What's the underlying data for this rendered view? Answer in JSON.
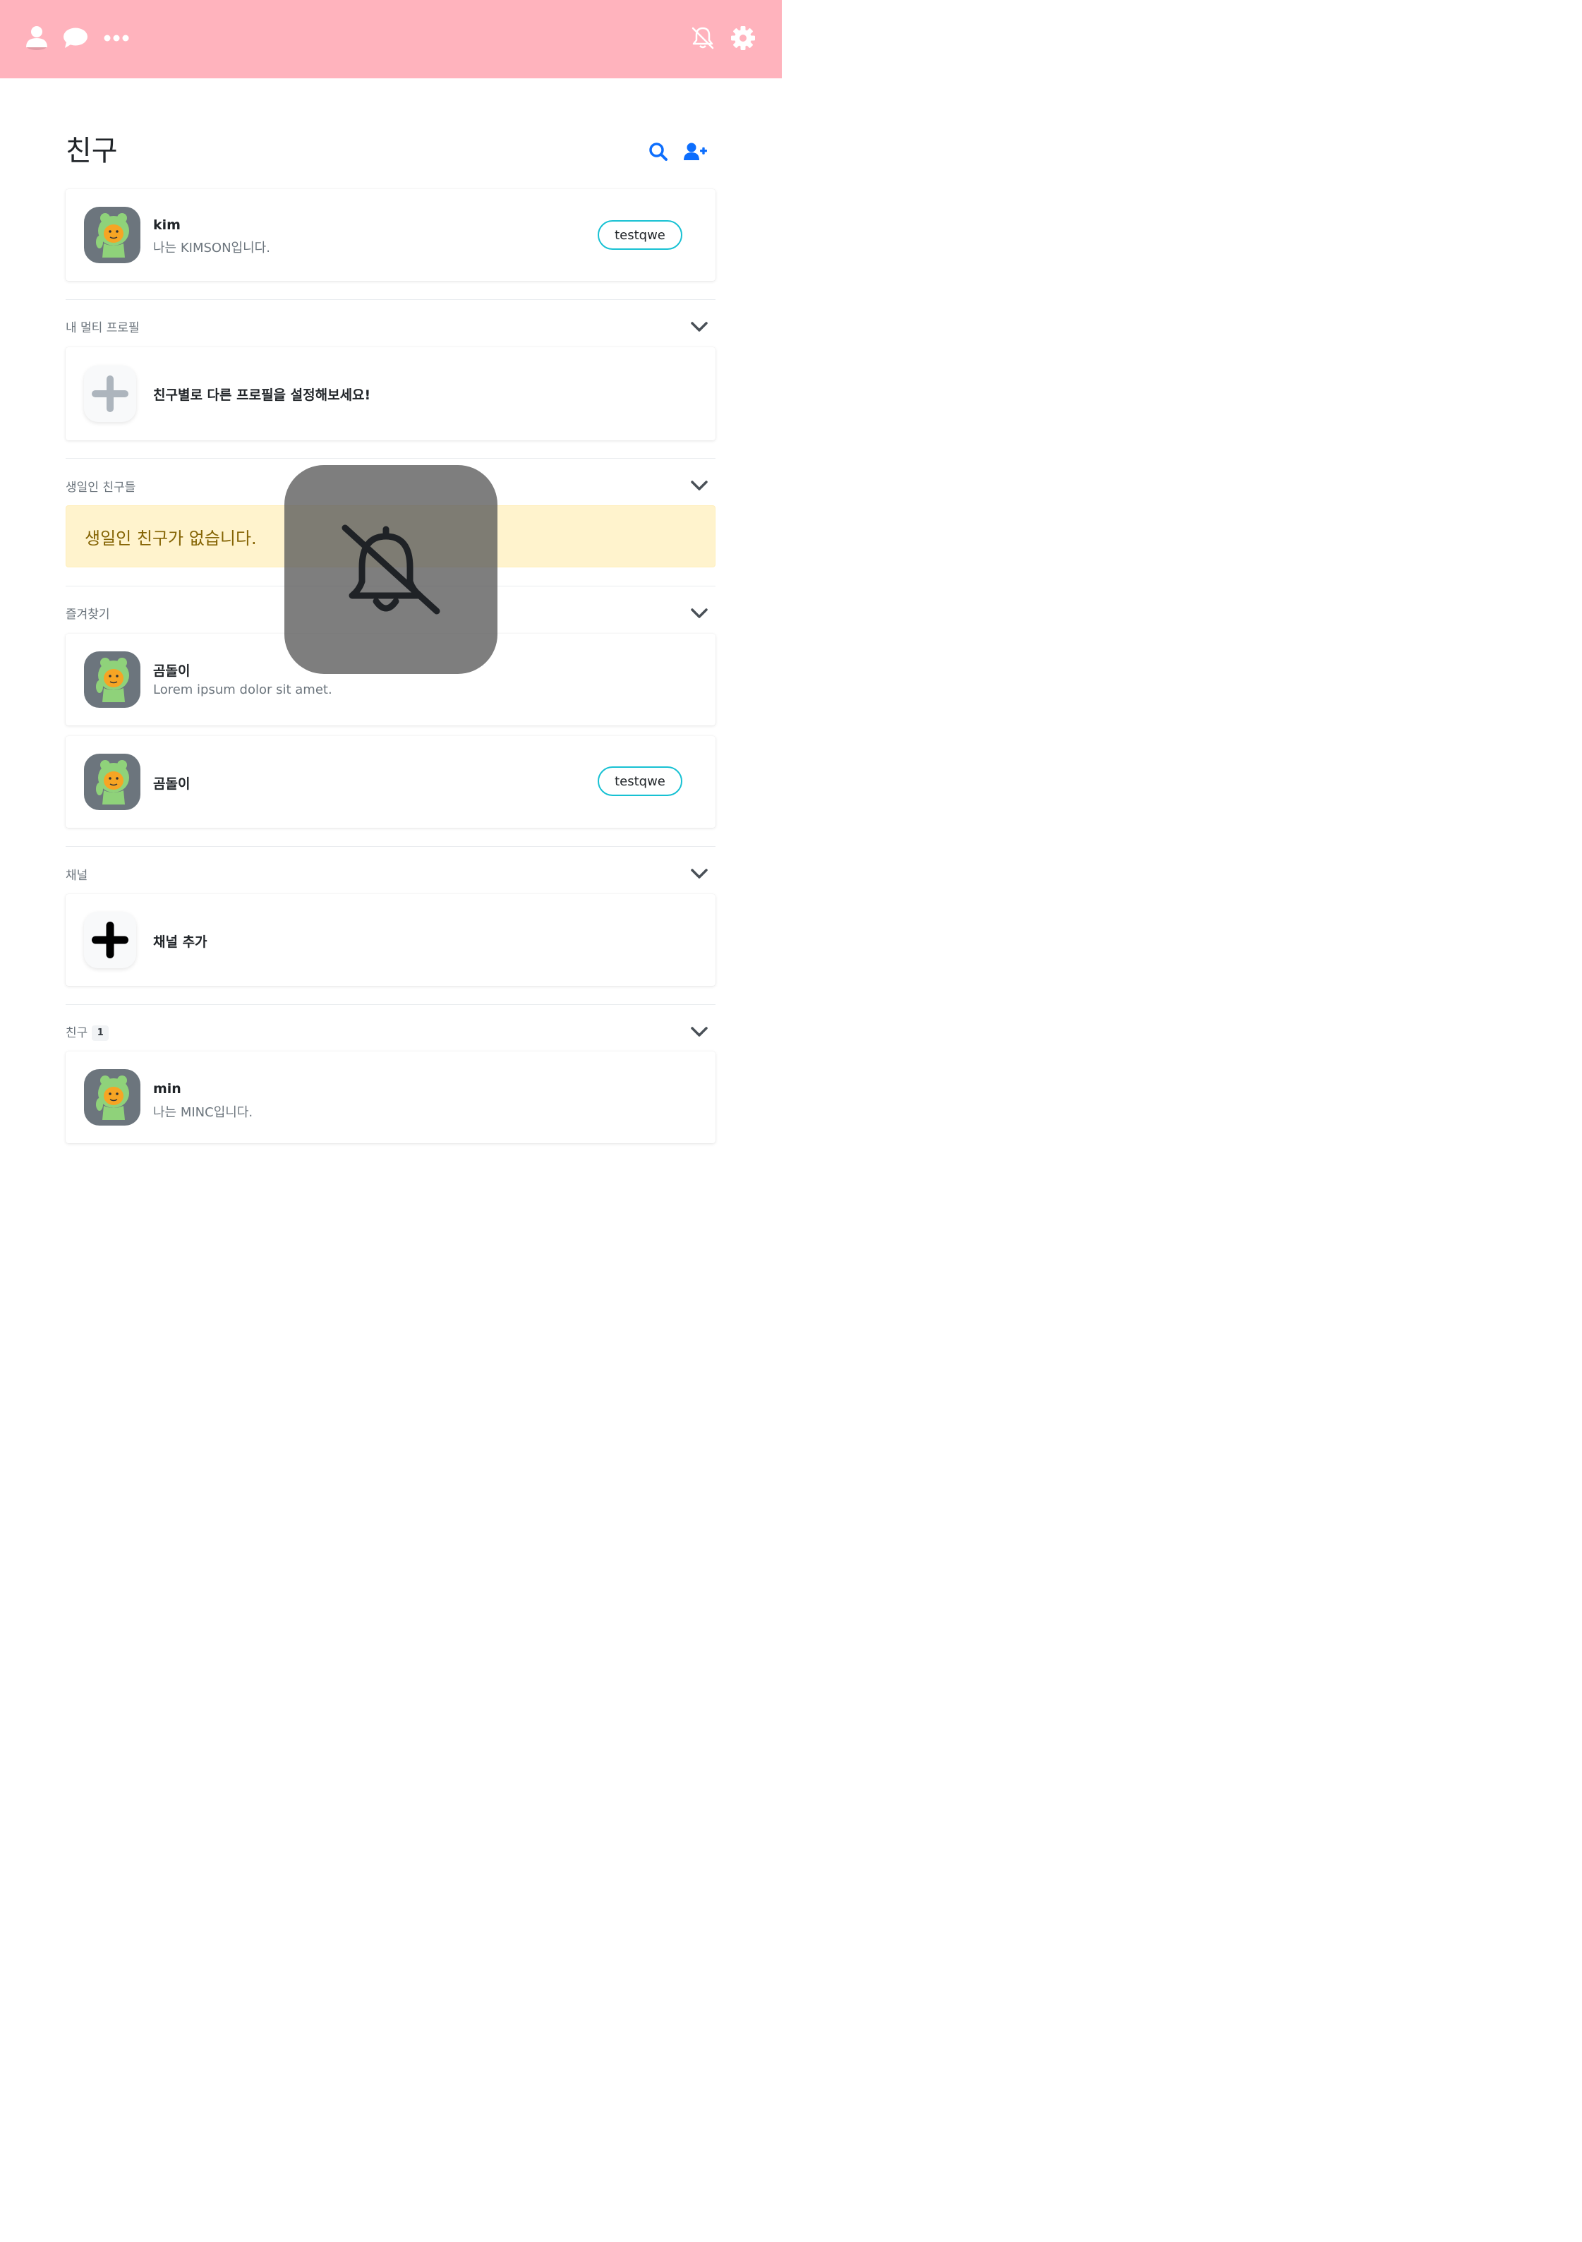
{
  "topbar": {
    "icons": [
      "user-icon",
      "chat-icon",
      "more-icon",
      "bell-slash-icon",
      "gear-icon"
    ],
    "color": "#ffb3bd"
  },
  "header": {
    "title": "친구",
    "icons": [
      "search-icon",
      "add-friend-icon"
    ],
    "accent": "#0d6efd"
  },
  "my_profile": {
    "name": "kim",
    "status": "나는 KIMSON입니다.",
    "music_label": "testqwe"
  },
  "sections": {
    "multi_profile": {
      "label": "내 멀티 프로필",
      "cta": "친구별로 다른 프로필을 설정해보세요!"
    },
    "birthday": {
      "label": "생일인 친구들",
      "empty_message": "생일인 친구가 없습니다."
    },
    "favorites": {
      "label": "즐겨찾기",
      "items": [
        {
          "name": "곰돌이",
          "status": "Lorem ipsum dolor sit amet."
        },
        {
          "name": "곰돌이",
          "music_label": "testqwe"
        }
      ]
    },
    "channel": {
      "label": "채널",
      "cta": "채널 추가"
    },
    "friends": {
      "label": "친구",
      "count": "1",
      "items": [
        {
          "name": "min",
          "status": "나는 MINC입니다."
        }
      ]
    }
  },
  "toast": {
    "icon": "bell-slash-icon"
  }
}
